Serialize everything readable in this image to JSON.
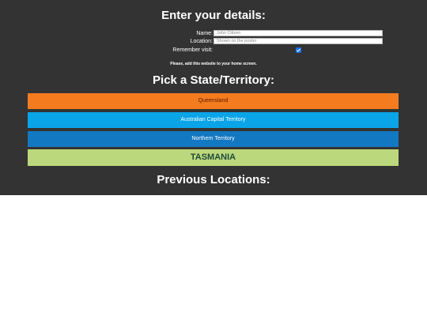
{
  "details": {
    "heading": "Enter your details:",
    "name_label": "Name:",
    "name_placeholder": "John Citizen",
    "location_label": "Location:",
    "location_placeholder": "Shown on the poster",
    "remember_label": "Remember visit:",
    "remember_checked": true,
    "home_screen_note": "Please, add this website to your home screen."
  },
  "states": {
    "heading": "Pick a State/Territory:",
    "items": [
      {
        "label": "Queensland",
        "color": "#f47c1f",
        "text_color": "#5a1a00"
      },
      {
        "label": "Australian Capital Territory",
        "color": "#0aa4e8",
        "text_color": "#ffffff"
      },
      {
        "label": "Northern Territory",
        "color": "#1378c2",
        "text_color": "#ffffff"
      },
      {
        "label": "TASMANIA",
        "color": "#bcd87c",
        "text_color": "#1f4a3c"
      }
    ]
  },
  "previous": {
    "heading": "Previous Locations:"
  }
}
